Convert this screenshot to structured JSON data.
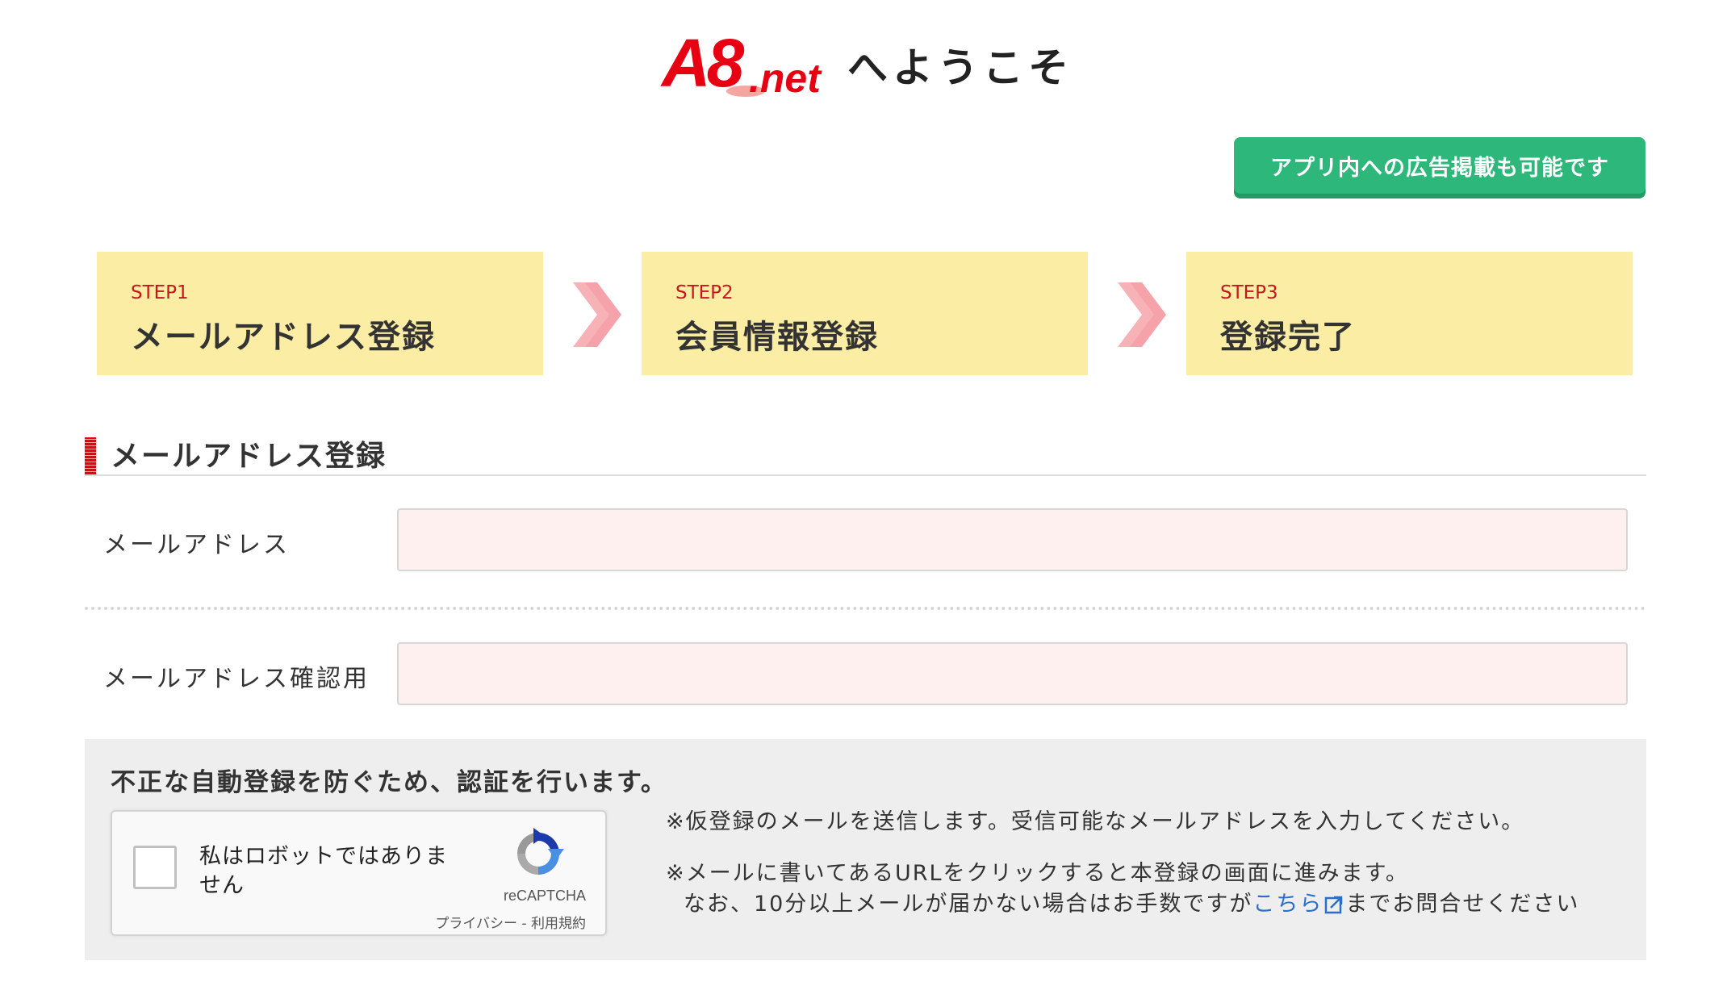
{
  "header": {
    "logo_main": "A8",
    "logo_sub": ".net",
    "welcome": "へようこそ"
  },
  "app_button": {
    "label": "アプリ内への広告掲載も可能です"
  },
  "steps": [
    {
      "num": "STEP1",
      "title": "メールアドレス登録"
    },
    {
      "num": "STEP2",
      "title": "会員情報登録"
    },
    {
      "num": "STEP3",
      "title": "登録完了"
    }
  ],
  "section": {
    "title": "メールアドレス登録"
  },
  "form": {
    "email_label": "メールアドレス",
    "email_value": "",
    "email_confirm_label": "メールアドレス確認用",
    "email_confirm_value": ""
  },
  "captcha": {
    "heading": "不正な自動登録を防ぐため、認証を行います。",
    "checkbox_label": "私はロボットではありません",
    "brand": "reCAPTCHA",
    "privacy": "プライバシー",
    "separator": " - ",
    "terms": "利用規約"
  },
  "notes": {
    "line1": "※仮登録のメールを送信します。受信可能なメールアドレスを入力してください。",
    "line2": "※メールに書いてあるURLをクリックすると本登録の画面に進みます。",
    "line3_prefix": "なお、10分以上メールが届かない場合はお手数ですが",
    "line3_link": "こちら",
    "line3_suffix": "までお問合せください"
  },
  "colors": {
    "brand_red": "#e60012",
    "step_bg": "#fbeda4",
    "app_button": "#2db77a",
    "input_bg": "#fff0f0",
    "link": "#2a6fc9"
  }
}
